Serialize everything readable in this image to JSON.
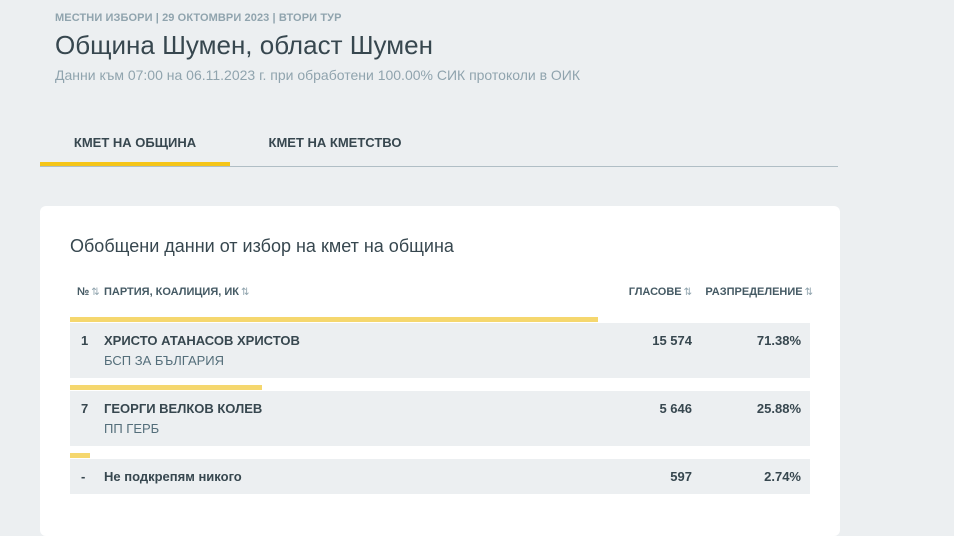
{
  "header": {
    "eyebrow": "МЕСТНИ ИЗБОРИ | 29 ОКТОМВРИ 2023 | ВТОРИ ТУР",
    "title": "Община Шумен, област Шумен",
    "subtitle": "Данни към 07:00 на 06.11.2023 г. при обработени 100.00% СИК протоколи в ОИК"
  },
  "tabs": [
    {
      "label": "КМЕТ НА ОБЩИНА",
      "active": true
    },
    {
      "label": "КМЕТ НА КМЕТСТВО",
      "active": false
    }
  ],
  "card": {
    "title": "Обобщени данни от избор на кмет на община"
  },
  "table": {
    "headers": {
      "num": "№",
      "party": "ПАРТИЯ, КОАЛИЦИЯ, ИК",
      "votes": "ГЛАСОВЕ",
      "distribution": "РАЗПРЕДЕЛЕНИЕ"
    },
    "sort_glyph": "⇅",
    "rows": [
      {
        "num": "1",
        "name": "ХРИСТО АТАНАСОВ ХРИСТОВ",
        "party": "БСП ЗА БЪЛГАРИЯ",
        "votes": "15 574",
        "pct": "71.38%",
        "share": 0.7138
      },
      {
        "num": "7",
        "name": "ГЕОРГИ ВЕЛКОВ КОЛЕВ",
        "party": "ПП ГЕРБ",
        "votes": "5 646",
        "pct": "25.88%",
        "share": 0.2588
      },
      {
        "num": "-",
        "name": "Не подкрепям никого",
        "party": "",
        "votes": "597",
        "pct": "2.74%",
        "share": 0.0274
      }
    ]
  },
  "colors": {
    "accent": "#f5c518",
    "bar": "#f5d76e",
    "background": "#eceff1",
    "row_background": "#eceff1"
  }
}
